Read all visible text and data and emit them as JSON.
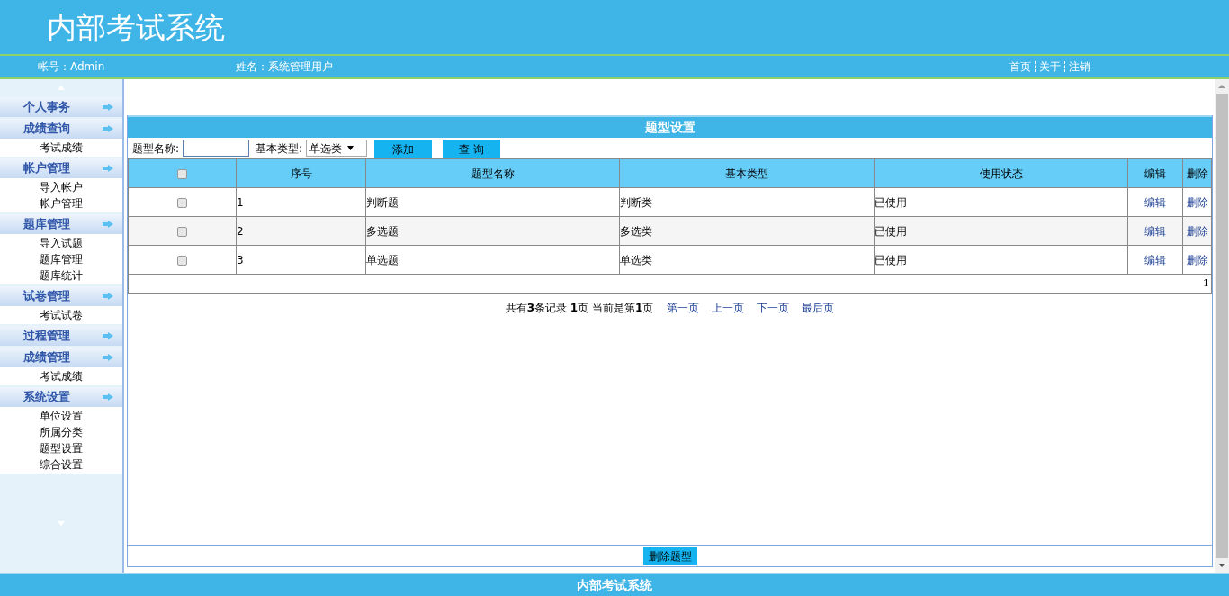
{
  "header": {
    "title": "内部考试系统"
  },
  "info_bar": {
    "account": "帐号：Admin",
    "name": "姓名：系统管理用户",
    "links": [
      "首页",
      "关于",
      "注销"
    ]
  },
  "sidebar": {
    "groups": [
      {
        "title": "个人事务"
      },
      {
        "title": "成绩查询",
        "items": [
          "考试成绩"
        ]
      },
      {
        "title": "帐户管理",
        "items": [
          "导入帐户",
          "帐户管理"
        ]
      },
      {
        "title": "题库管理",
        "items": [
          "导入试题",
          "题库管理",
          "题库统计"
        ]
      },
      {
        "title": "试卷管理",
        "items": [
          "考试试卷"
        ]
      },
      {
        "title": "过程管理"
      },
      {
        "title": "成绩管理",
        "items": [
          "考试成绩"
        ]
      },
      {
        "title": "系统设置",
        "items": [
          "单位设置",
          "所属分类",
          "题型设置",
          "综合设置"
        ]
      }
    ]
  },
  "panel": {
    "title": "题型设置",
    "filter": {
      "name_label": "题型名称:",
      "type_label": "基本类型:",
      "type_value": "单选类",
      "buttons": [
        "添加",
        "查 询"
      ]
    },
    "table": {
      "header_checked": false,
      "columns": [
        "序号",
        "题型名称",
        "基本类型",
        "使用状态",
        "编辑",
        "删除"
      ],
      "rows": [
        {
          "checked": false,
          "cells": [
            "1",
            "判断题",
            "判断类",
            "已使用"
          ],
          "edit": "编辑",
          "delete": "删除"
        },
        {
          "checked": false,
          "cells": [
            "2",
            "多选题",
            "多选类",
            "已使用"
          ],
          "edit": "编辑",
          "delete": "删除"
        },
        {
          "checked": false,
          "cells": [
            "3",
            "单选题",
            "单选类",
            "已使用"
          ],
          "edit": "编辑",
          "delete": "删除"
        }
      ],
      "footer": "1"
    },
    "pagination": {
      "summary": "共有**3**条记录 **1**页 当前是第**1**页",
      "links": [
        "第一页",
        "上一页",
        "下一页",
        "最后页"
      ]
    },
    "bottom_button": "删除题型"
  },
  "footer": {
    "text": "内部考试系统"
  }
}
